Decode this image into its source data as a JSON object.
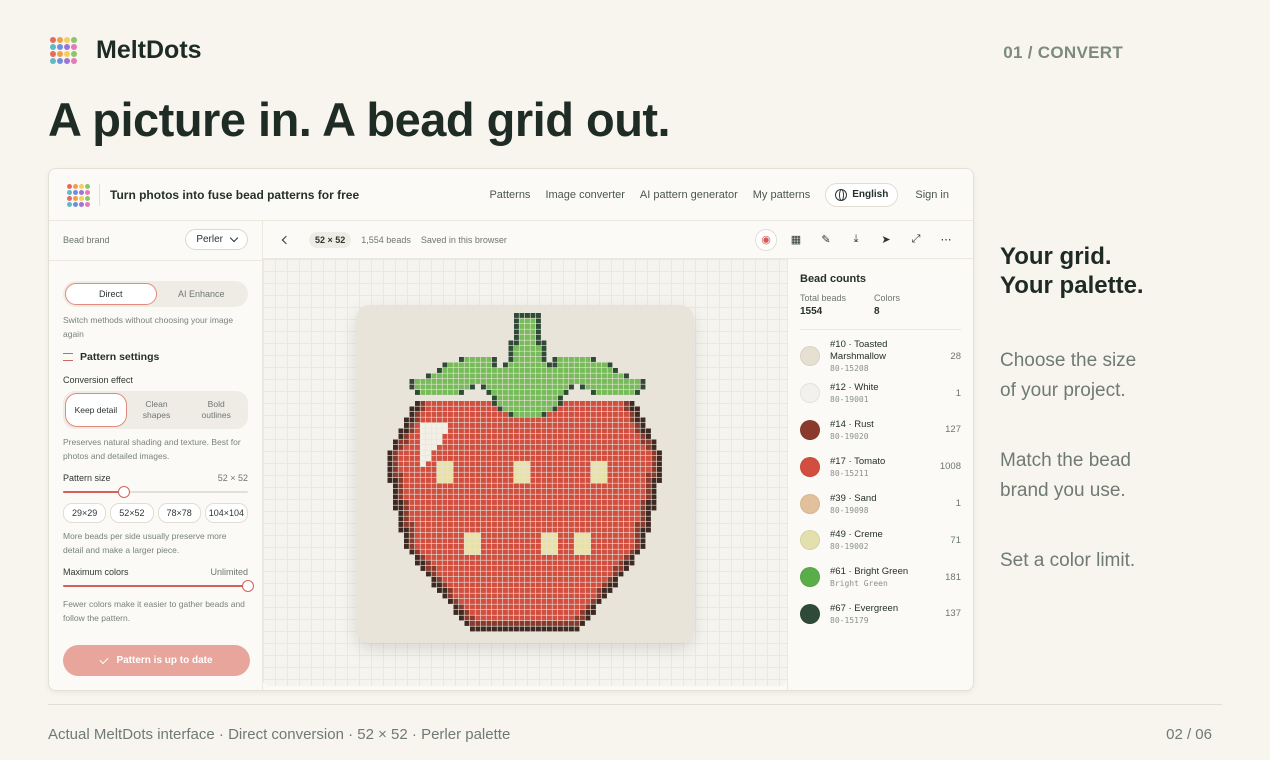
{
  "brand": {
    "name": "MeltDots"
  },
  "slide": {
    "section": "01 / CONVERT",
    "headline": "A picture in. A bead grid out.",
    "side_title_1": "Your grid.",
    "side_title_2": "Your palette.",
    "points": [
      [
        "Choose the size",
        "of your project."
      ],
      [
        "Match the bead",
        "brand you use."
      ],
      [
        "Set a color limit."
      ]
    ],
    "caption": "Actual MeltDots interface · Direct conversion · 52 × 52 · Perler palette",
    "page": "02 / 06"
  },
  "logo_colors": [
    "#e46b5f",
    "#f0a04b",
    "#f4cf5a",
    "#8cc56b",
    "#5fb9c9",
    "#6d8fe0",
    "#a173d6",
    "#e27bb6",
    "#e46b5f",
    "#f0a04b",
    "#f4cf5a",
    "#8cc56b",
    "#5fb9c9",
    "#6d8fe0",
    "#a173d6",
    "#e27bb6"
  ],
  "app": {
    "title": "Turn photos into fuse bead patterns for free",
    "nav": [
      "Patterns",
      "Image converter",
      "AI pattern generator",
      "My patterns"
    ],
    "language": "English",
    "signin": "Sign in"
  },
  "sidebar": {
    "brand_label": "Bead brand",
    "brand_value": "Perler",
    "modes": [
      "Direct",
      "AI Enhance"
    ],
    "modes_help": "Switch methods without choosing your image again",
    "settings_title": "Pattern settings",
    "effect_label": "Conversion effect",
    "effects": [
      [
        "Keep detail"
      ],
      [
        "Clean",
        "shapes"
      ],
      [
        "Bold",
        "outlines"
      ]
    ],
    "effect_help": "Preserves natural shading and texture. Best for photos and detailed images.",
    "size_label": "Pattern size",
    "size_value": "52 × 52",
    "size_slider": 0.33,
    "sizes": [
      "29×29",
      "52×52",
      "78×78",
      "104×104"
    ],
    "size_help": "More beads per side usually preserve more detail and make a larger piece.",
    "colors_label": "Maximum colors",
    "colors_value": "Unlimited",
    "colors_slider": 1.0,
    "colors_help": "Fewer colors make it easier to gather beads and follow the pattern.",
    "cta": "Pattern is up to date"
  },
  "toolbar": {
    "grid_size": "52 × 52",
    "beads": "1,554 beads",
    "saved": "Saved in this browser"
  },
  "counts": {
    "title": "Bead counts",
    "total_label": "Total beads",
    "total": "1554",
    "colors_label": "Colors",
    "colors": "8",
    "items": [
      {
        "name": [
          "#10 · Toasted",
          "Marshmallow"
        ],
        "code": "80-15208",
        "count": "28",
        "color": "#e6e0d2"
      },
      {
        "name": [
          "#12 · White"
        ],
        "code": "80-19001",
        "count": "1",
        "color": "#f2f1ed"
      },
      {
        "name": [
          "#14 · Rust"
        ],
        "code": "80-19020",
        "count": "127",
        "color": "#8a3a2c"
      },
      {
        "name": [
          "#17 · Tomato"
        ],
        "code": "80-15211",
        "count": "1008",
        "color": "#d24e3f"
      },
      {
        "name": [
          "#39 · Sand"
        ],
        "code": "80-19098",
        "count": "1",
        "color": "#e2c09b"
      },
      {
        "name": [
          "#49 · Creme"
        ],
        "code": "80-19002",
        "count": "71",
        "color": "#e3e0ad"
      },
      {
        "name": [
          "#61 · Bright Green"
        ],
        "code": "Bright Green",
        "count": "181",
        "color": "#5aae4a"
      },
      {
        "name": [
          "#67 · Evergreen"
        ],
        "code": "80-15179",
        "count": "137",
        "color": "#2f4a37"
      }
    ]
  },
  "pattern_colors": {
    "outline": "#3e2a23",
    "rust": "#8a3a2c",
    "body": "#d24e3f",
    "seed": "#e8e1aa",
    "leaf": "#77bb5a",
    "leaf_dark": "#2f4a37",
    "highlight": "#f2efe6"
  }
}
